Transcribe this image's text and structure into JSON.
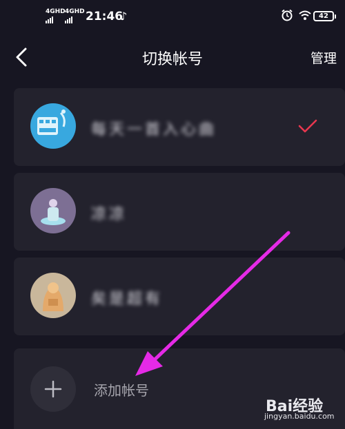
{
  "status_bar": {
    "sim1": "4GHD",
    "sim2": "4GHD",
    "time": "21:46",
    "battery": "42"
  },
  "nav": {
    "title": "切换帐号",
    "manage": "管理"
  },
  "accounts": [
    {
      "name": "每天一首入心曲",
      "selected": true
    },
    {
      "name": "凉凉",
      "selected": false
    },
    {
      "name": "矣是超有",
      "selected": false
    }
  ],
  "add_account": {
    "label": "添加帐号"
  },
  "watermark": {
    "logo": "Bai经验",
    "url": "jingyan.baidu.com"
  },
  "colors": {
    "background": "#171622",
    "card": "#23222d",
    "check": "#e8374f",
    "annotation_arrow": "#e52ae6"
  }
}
